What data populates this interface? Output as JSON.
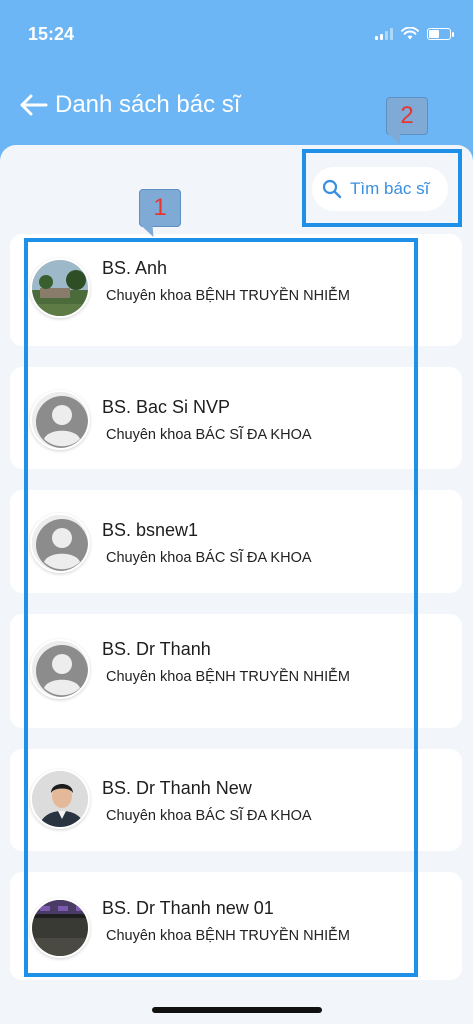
{
  "status": {
    "time": "15:24",
    "battery_level": 0.55
  },
  "header": {
    "title": "Danh sách bác sĩ"
  },
  "search": {
    "placeholder": "Tìm bác sĩ"
  },
  "doctors": [
    {
      "name": "BS. Anh",
      "specialty": "Chuyên khoa BỆNH TRUYỀN NHIỄM",
      "avatar": "landscape-photo"
    },
    {
      "name": "BS. Bac Si NVP",
      "specialty": "Chuyên khoa BÁC SĨ ĐA KHOA",
      "avatar": "default-user-icon"
    },
    {
      "name": "BS. bsnew1",
      "specialty": "Chuyên khoa BÁC SĨ ĐA KHOA",
      "avatar": "default-user-icon"
    },
    {
      "name": "BS. Dr Thanh",
      "specialty": "Chuyên khoa BỆNH TRUYỀN NHIỄM",
      "avatar": "default-user-icon"
    },
    {
      "name": "BS. Dr Thanh New",
      "specialty": "Chuyên khoa BÁC SĨ ĐA KHOA",
      "avatar": "person-photo"
    },
    {
      "name": "BS. Dr Thanh new 01",
      "specialty": "Chuyên khoa BỆNH TRUYỀN NHIỄM",
      "avatar": "dark-photo"
    }
  ],
  "annotations": [
    {
      "label": "1"
    },
    {
      "label": "2"
    }
  ],
  "colors": {
    "header_bg": "#6CB6F5",
    "accent": "#3A8FE0",
    "annotation_border": "#1E90E8",
    "annotation_text": "#E8362E"
  }
}
